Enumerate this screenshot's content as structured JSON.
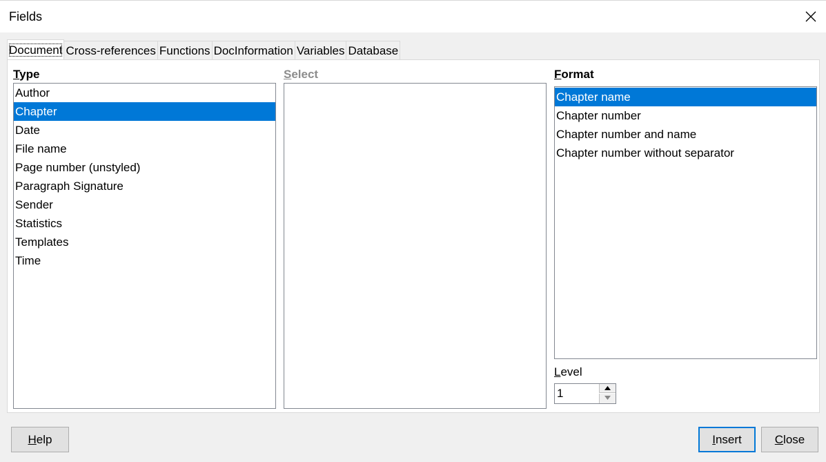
{
  "window": {
    "title": "Fields",
    "close_icon": "close-icon"
  },
  "tabs": [
    {
      "label": "Document",
      "active": true
    },
    {
      "label": "Cross-references",
      "active": false
    },
    {
      "label": "Functions",
      "active": false
    },
    {
      "label": "DocInformation",
      "active": false
    },
    {
      "label": "Variables",
      "active": false
    },
    {
      "label": "Database",
      "active": false
    }
  ],
  "type_group": {
    "label_mnemonic": "T",
    "label_rest": "ype",
    "items": [
      "Author",
      "Chapter",
      "Date",
      "File name",
      "Page number (unstyled)",
      "Paragraph Signature",
      "Sender",
      "Statistics",
      "Templates",
      "Time"
    ],
    "selected_index": 1
  },
  "select_group": {
    "label_mnemonic": "S",
    "label_rest": "elect",
    "items": []
  },
  "format_group": {
    "label_mnemonic": "F",
    "label_rest": "ormat",
    "items": [
      "Chapter name",
      "Chapter number",
      "Chapter number and name",
      "Chapter number without separator"
    ],
    "selected_index": 0
  },
  "level": {
    "label_mnemonic": "L",
    "label_rest": "evel",
    "value": "1"
  },
  "buttons": {
    "help": {
      "mnemonic": "H",
      "rest": "elp"
    },
    "insert": {
      "mnemonic": "I",
      "rest": "nsert"
    },
    "close": {
      "mnemonic": "C",
      "rest": "lose"
    }
  },
  "colors": {
    "selection": "#0078d7",
    "dialog_bg": "#f0f0f0",
    "disabled_text": "#8c8c8c"
  }
}
